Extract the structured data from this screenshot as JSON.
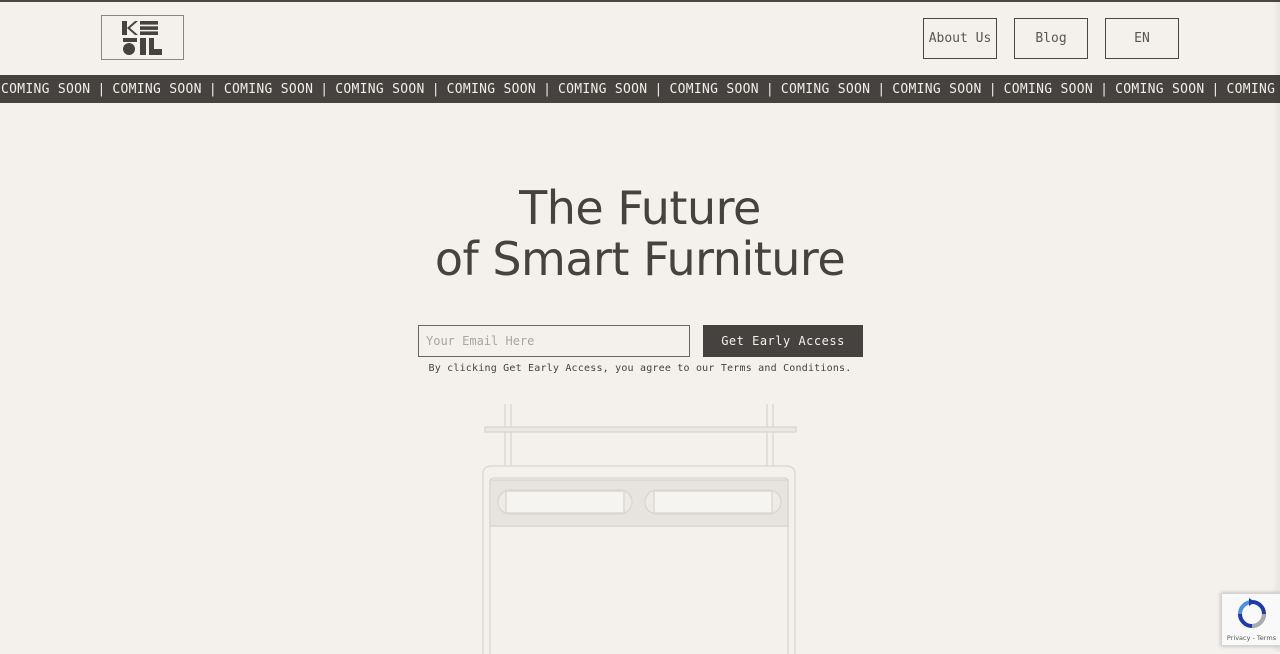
{
  "header": {
    "nav": [
      {
        "label": "About Us"
      },
      {
        "label": "Blog"
      },
      {
        "label": "EN"
      }
    ]
  },
  "ticker": {
    "text": "COMING SOON",
    "separator": "|"
  },
  "hero": {
    "title_line1": "The Future",
    "title_line2": "of Smart Furniture"
  },
  "signup": {
    "email_placeholder": "Your Email Here",
    "email_value": "",
    "button_label": "Get Early Access",
    "terms_prefix": "By clicking Get Early Access, you agree to our ",
    "terms_link": "Terms and Conditions",
    "terms_suffix": "."
  },
  "recaptcha": {
    "links": "Privacy - Terms"
  },
  "colors": {
    "background": "#f4f1ec",
    "dark": "#464240",
    "text_light": "#f1ede8"
  }
}
